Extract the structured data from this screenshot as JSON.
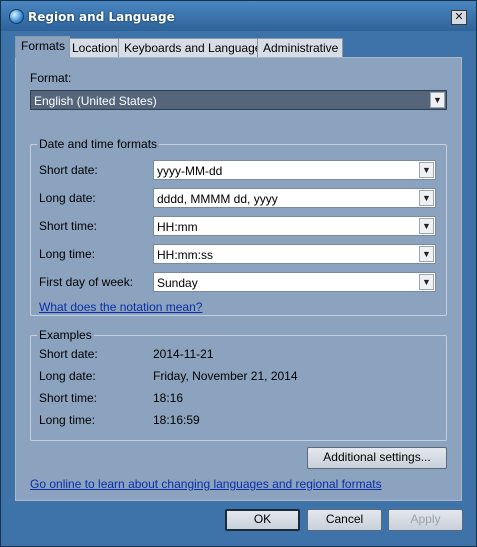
{
  "window": {
    "title": "Region and Language"
  },
  "tabs": [
    {
      "label": "Formats"
    },
    {
      "label": "Location"
    },
    {
      "label": "Keyboards and Languages"
    },
    {
      "label": "Administrative"
    }
  ],
  "format": {
    "label": "Format:",
    "value": "English (United States)"
  },
  "date_time_formats": {
    "title": "Date and time formats",
    "short_date": {
      "label": "Short date:",
      "value": "yyyy-MM-dd"
    },
    "long_date": {
      "label": "Long date:",
      "value": "dddd, MMMM dd, yyyy"
    },
    "short_time": {
      "label": "Short time:",
      "value": "HH:mm"
    },
    "long_time": {
      "label": "Long time:",
      "value": "HH:mm:ss"
    },
    "first_day": {
      "label": "First day of week:",
      "value": "Sunday"
    },
    "notation_link": "What does the notation mean?"
  },
  "examples": {
    "title": "Examples",
    "short_date": {
      "label": "Short date:",
      "value": "2014-11-21"
    },
    "long_date": {
      "label": "Long date:",
      "value": "Friday, November 21, 2014"
    },
    "short_time": {
      "label": "Short time:",
      "value": "18:16"
    },
    "long_time": {
      "label": "Long time:",
      "value": "18:16:59"
    }
  },
  "additional_settings": "Additional settings...",
  "online_link": "Go online to learn about changing languages and regional formats",
  "buttons": {
    "ok": "OK",
    "cancel": "Cancel",
    "apply": "Apply"
  },
  "icons": {
    "title": "globe-icon",
    "close": "close-icon",
    "dropdown": "chevron-down-icon"
  }
}
